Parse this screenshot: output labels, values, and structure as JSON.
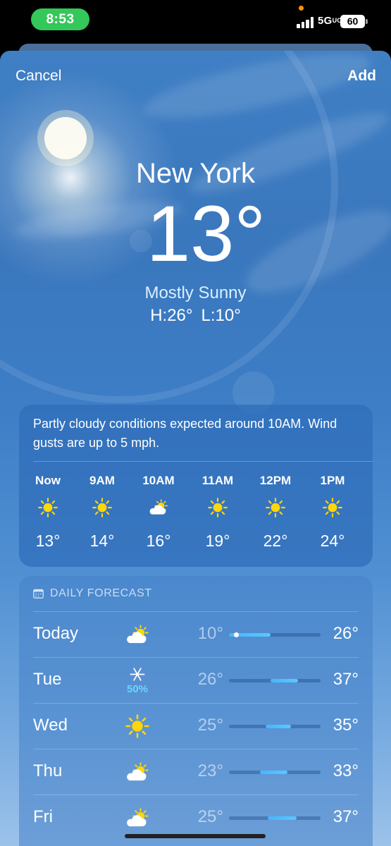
{
  "status_bar": {
    "time": "8:53",
    "network": "5G",
    "network_suffix": "UC",
    "battery": "60"
  },
  "header": {
    "cancel_label": "Cancel",
    "add_label": "Add"
  },
  "current": {
    "city": "New York",
    "temperature": "13°",
    "condition": "Mostly Sunny",
    "high": "H:26°",
    "low": "L:10°"
  },
  "hourly": {
    "summary": "Partly cloudy conditions expected around 10AM. Wind gusts are up to 5 mph.",
    "items": [
      {
        "time": "Now",
        "icon": "sun-icon",
        "temp": "13°"
      },
      {
        "time": "9AM",
        "icon": "sun-icon",
        "temp": "14°"
      },
      {
        "time": "10AM",
        "icon": "partly-cloudy-icon",
        "temp": "16°"
      },
      {
        "time": "11AM",
        "icon": "sun-icon",
        "temp": "19°"
      },
      {
        "time": "12PM",
        "icon": "sun-icon",
        "temp": "22°"
      },
      {
        "time": "1PM",
        "icon": "sun-icon",
        "temp": "24°"
      }
    ]
  },
  "daily": {
    "title": "DAILY FORECAST",
    "days": [
      {
        "day": "Today",
        "icon": "partly-cloudy-icon",
        "precip": "",
        "low": "10°",
        "high": "26°",
        "range_start": 0.0,
        "range_end": 0.45,
        "current_marker": 0.08
      },
      {
        "day": "Tue",
        "icon": "snowflake-icon",
        "precip": "50%",
        "low": "26°",
        "high": "37°",
        "range_start": 0.45,
        "range_end": 0.75
      },
      {
        "day": "Wed",
        "icon": "sun-icon",
        "precip": "",
        "low": "25°",
        "high": "35°",
        "range_start": 0.4,
        "range_end": 0.68
      },
      {
        "day": "Thu",
        "icon": "partly-cloudy-icon",
        "precip": "",
        "low": "23°",
        "high": "33°",
        "range_start": 0.34,
        "range_end": 0.64
      },
      {
        "day": "Fri",
        "icon": "partly-cloudy-icon",
        "precip": "",
        "low": "25°",
        "high": "37°",
        "range_start": 0.42,
        "range_end": 0.74
      }
    ]
  },
  "colors": {
    "time_pill": "#34c759",
    "accent_blue": "#5ac8ff",
    "sun_yellow": "#ffd60a"
  }
}
